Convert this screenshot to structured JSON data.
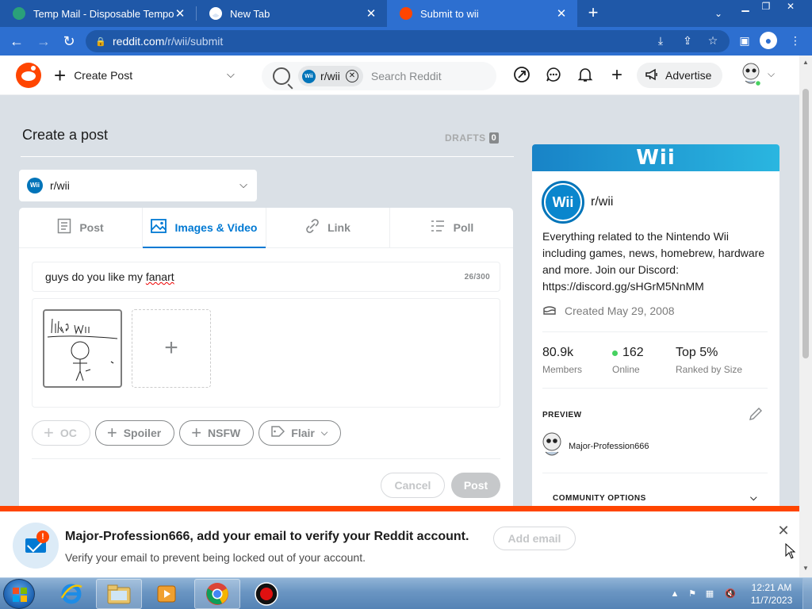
{
  "browser": {
    "tabs": [
      {
        "title": "Temp Mail - Disposable Tempora",
        "active": false
      },
      {
        "title": "New Tab",
        "active": false
      },
      {
        "title": "Submit to wii",
        "active": true
      }
    ],
    "url_host": "reddit.com",
    "url_path": "/r/wii/submit"
  },
  "header": {
    "create_post": "Create Post",
    "search_chip": "r/wii",
    "search_placeholder": "Search Reddit",
    "advertise": "Advertise"
  },
  "compose": {
    "page_title": "Create a post",
    "drafts_label": "DRAFTS",
    "drafts_count": "0",
    "community": "r/wii",
    "community_icon_text": "Wii",
    "tabs": [
      {
        "label": "Post",
        "icon": "post-icon"
      },
      {
        "label": "Images & Video",
        "icon": "image-icon",
        "active": true
      },
      {
        "label": "Link",
        "icon": "link-icon"
      },
      {
        "label": "Poll",
        "icon": "poll-icon"
      }
    ],
    "title_pre": "guys do you like my ",
    "title_misspelled": "fanart",
    "title_counter": "26/300",
    "tags": [
      {
        "label": "OC",
        "disabled": true
      },
      {
        "label": "Spoiler"
      },
      {
        "label": "NSFW"
      },
      {
        "label": "Flair"
      }
    ],
    "cancel": "Cancel",
    "post": "Post"
  },
  "sidebar": {
    "banner_text": "Wii",
    "icon_text": "Wii",
    "name": "r/wii",
    "description": "Everything related to the Nintendo Wii including games, news, homebrew, hardware and more. Join our Discord: https://discord.gg/sHGrM5NnMM",
    "created": "Created May 29, 2008",
    "stats": [
      {
        "value": "80.9k",
        "label": "Members"
      },
      {
        "value": "162",
        "label": "Online"
      },
      {
        "value": "Top 5%",
        "label": "Ranked by Size"
      }
    ],
    "preview_label": "PREVIEW",
    "preview_user": "Major-Profession666",
    "community_options": "COMMUNITY OPTIONS"
  },
  "email_banner": {
    "title": "Major-Profession666, add your email to verify your Reddit account.",
    "subtitle": "Verify your email to prevent being locked out of your account.",
    "button": "Add email"
  },
  "taskbar": {
    "time": "12:21 AM",
    "date": "11/7/2023"
  },
  "colors": {
    "reddit_orange": "#ff4500",
    "reddit_blue": "#0079d3",
    "chrome_tab_bg": "#1f58a8",
    "chrome_toolbar": "#2d6fd0"
  }
}
